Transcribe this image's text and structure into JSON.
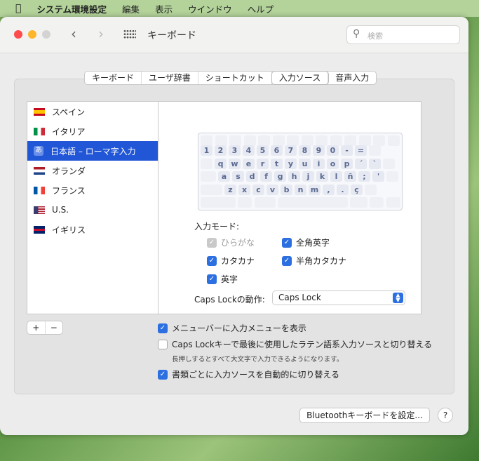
{
  "menubar": {
    "apple": "",
    "app": "システム環境設定",
    "items": [
      "編集",
      "表示",
      "ウインドウ",
      "ヘルプ"
    ]
  },
  "toolbar": {
    "title": "キーボード",
    "search_placeholder": "検索"
  },
  "tabs": [
    "キーボード",
    "ユーザ辞書",
    "ショートカット",
    "入力ソース",
    "音声入力"
  ],
  "selected_tab": "入力ソース",
  "sources": [
    {
      "label": "スペイン",
      "flag": "es"
    },
    {
      "label": "イタリア",
      "flag": "it"
    },
    {
      "label": "日本語 – ローマ字入力",
      "flag": "ja",
      "selected": true
    },
    {
      "label": "オランダ",
      "flag": "nl"
    },
    {
      "label": "フランス",
      "flag": "fr"
    },
    {
      "label": "U.S.",
      "flag": "us"
    },
    {
      "label": "イギリス",
      "flag": "gb"
    }
  ],
  "keyboard_rows": [
    [
      "1",
      "2",
      "3",
      "4",
      "5",
      "6",
      "7",
      "8",
      "9",
      "0",
      "-",
      "="
    ],
    [
      "q",
      "w",
      "e",
      "r",
      "t",
      "y",
      "u",
      "i",
      "o",
      "p",
      "´",
      "`"
    ],
    [
      "a",
      "s",
      "d",
      "f",
      "g",
      "h",
      "j",
      "k",
      "l",
      "ñ",
      ";",
      "'"
    ],
    [
      "z",
      "x",
      "c",
      "v",
      "b",
      "n",
      "m",
      ",",
      ".",
      "ç"
    ]
  ],
  "input_mode": {
    "label": "入力モード:",
    "options": [
      {
        "label": "ひらがな",
        "state": "disabled-checked"
      },
      {
        "label": "全角英字",
        "state": "checked"
      },
      {
        "label": "カタカナ",
        "state": "checked"
      },
      {
        "label": "半角カタカナ",
        "state": "checked"
      },
      {
        "label": "英字",
        "state": "checked"
      }
    ]
  },
  "capslock": {
    "label": "Caps Lockの動作:",
    "value": "Caps Lock"
  },
  "list_buttons": {
    "add": "+",
    "remove": "−"
  },
  "options": [
    {
      "label": "メニューバーに入力メニューを表示",
      "checked": true
    },
    {
      "label": "Caps Lockキーで最後に使用したラテン語系入力ソースと切り替える",
      "checked": false,
      "note": "長押しするとすべて大文字で入力できるようになります。"
    },
    {
      "label": "書類ごとに入力ソースを自動的に切り替える",
      "checked": true
    }
  ],
  "bluetooth_button": "Bluetoothキーボードを設定...",
  "help_button": "?",
  "colors": {
    "accent": "#2c6fe0",
    "selection": "#2157d6"
  }
}
